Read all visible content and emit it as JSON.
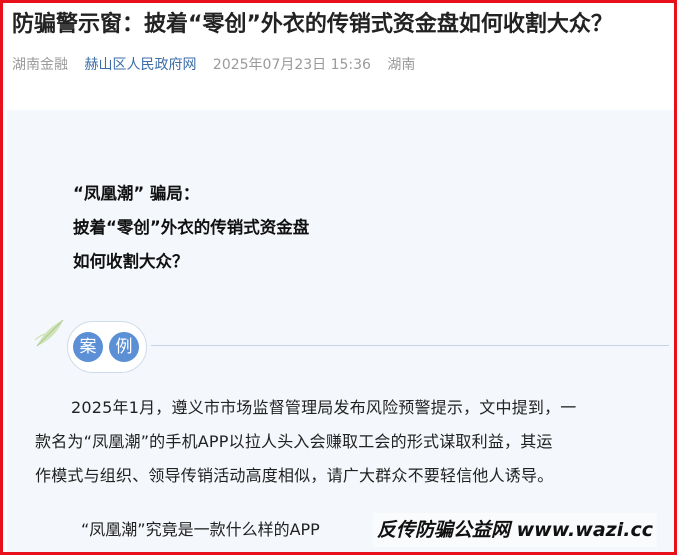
{
  "article": {
    "title": "防骗警示窗：披着“零创”外衣的传销式资金盘如何收割大众？",
    "meta": {
      "account": "湖南金融",
      "source": "赫山区人民政府网",
      "datetime": "2025年07月23日 15:36",
      "region": "湖南"
    }
  },
  "lead": {
    "line1": "“凤凰潮” 骗局：",
    "line2": "披着“零创”外衣的传销式资金盘",
    "line3": "如何收割大众？"
  },
  "section": {
    "badge_char_1": "案",
    "badge_char_2": "例"
  },
  "body": {
    "line1": "2025年1月，遵义市市场监督管理局发布风险预警提示，文中提到，一",
    "line2": "款名为“凤凰潮”的手机APP以拉人头入会赚取工会的形式谋取利益，其运",
    "line3": "作模式与组织、领导传销活动高度相似，请广大群众不要轻信他人诱导。",
    "question": "“凤凰潮”究竟是一款什么样的APP"
  },
  "watermark": {
    "text": "反传防骗公益网 www.wazi.cc"
  },
  "colors": {
    "border": "#e8101a",
    "panel": "#f4f7fb",
    "badge": "#5b8fd6",
    "link": "#3d6ea8"
  },
  "icons": {
    "leaf": "leaf-icon"
  }
}
